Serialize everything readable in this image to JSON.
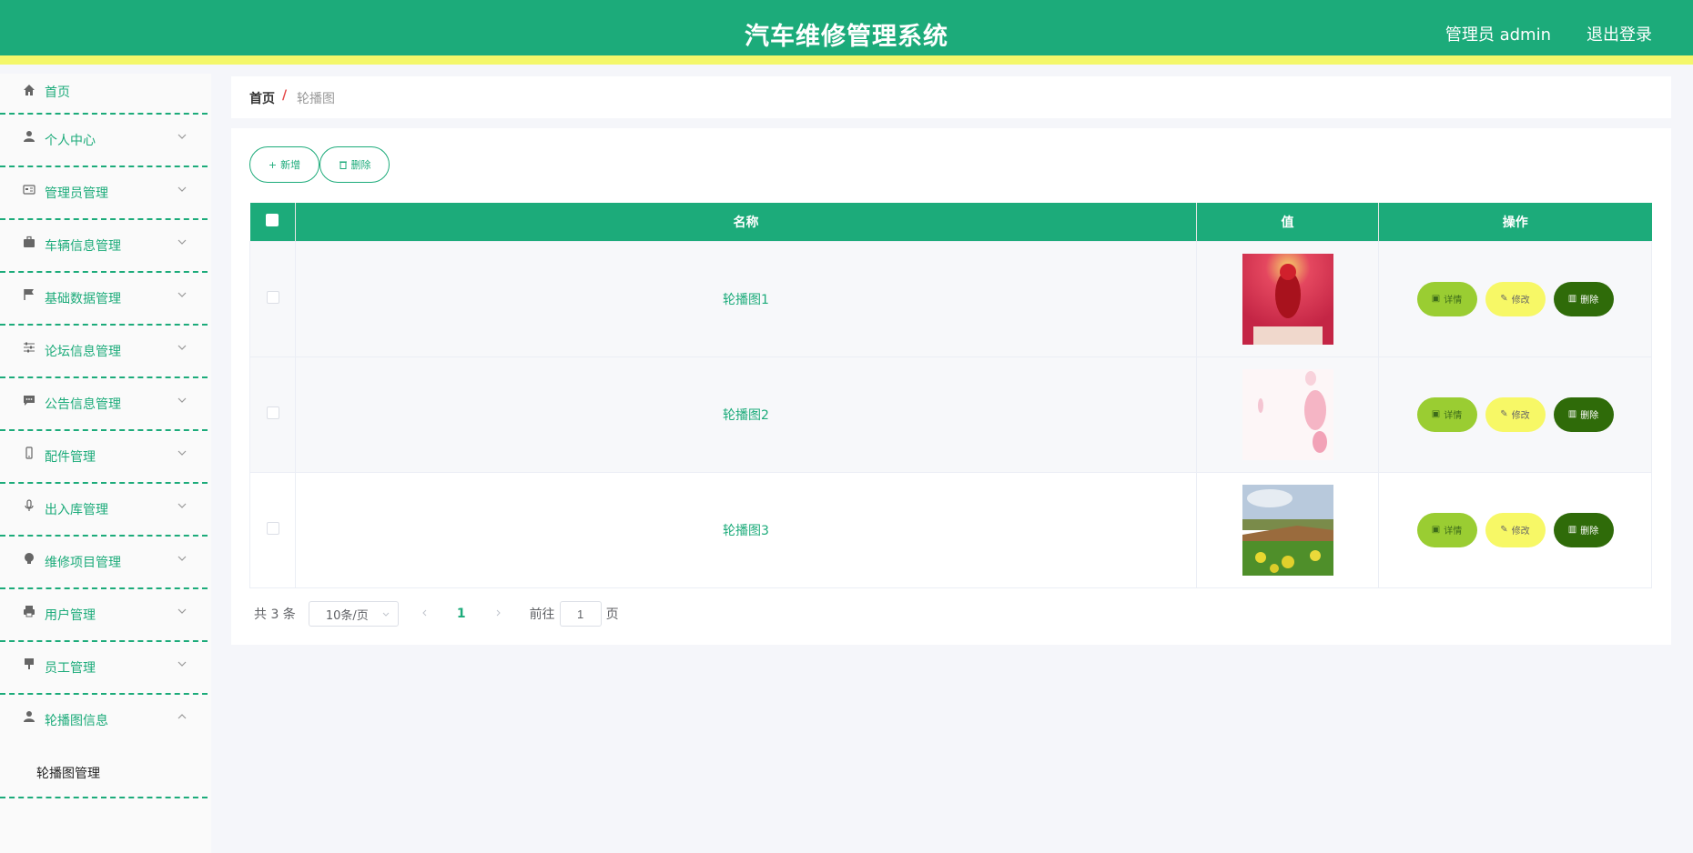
{
  "header": {
    "title": "汽车维修管理系统",
    "user": "管理员 admin",
    "logout": "退出登录"
  },
  "sidebar": {
    "items": [
      {
        "label": "首页",
        "icon": "home-icon"
      },
      {
        "label": "个人中心",
        "icon": "user-icon"
      },
      {
        "label": "管理员管理",
        "icon": "id-card-icon"
      },
      {
        "label": "车辆信息管理",
        "icon": "briefcase-icon"
      },
      {
        "label": "基础数据管理",
        "icon": "flag-icon"
      },
      {
        "label": "论坛信息管理",
        "icon": "sliders-icon"
      },
      {
        "label": "公告信息管理",
        "icon": "chat-icon"
      },
      {
        "label": "配件管理",
        "icon": "phone-icon"
      },
      {
        "label": "出入库管理",
        "icon": "microphone-icon"
      },
      {
        "label": "维修项目管理",
        "icon": "bulb-icon"
      },
      {
        "label": "用户管理",
        "icon": "printer-icon"
      },
      {
        "label": "员工管理",
        "icon": "stamp-icon"
      },
      {
        "label": "轮播图信息",
        "icon": "user-icon"
      }
    ],
    "submenu": {
      "label": "轮播图管理"
    }
  },
  "breadcrumb": {
    "home": "首页",
    "separator": "/",
    "current": "轮播图"
  },
  "toolbar": {
    "add_label": "新增",
    "delete_label": "删除"
  },
  "table": {
    "columns": [
      "名称",
      "值",
      "操作"
    ],
    "rows": [
      {
        "name": "轮播图1",
        "image": "red-figure"
      },
      {
        "name": "轮播图2",
        "image": "pink-petals"
      },
      {
        "name": "轮播图3",
        "image": "flower-field"
      }
    ],
    "actions": {
      "detail": "详情",
      "edit": "修改",
      "delete": "删除"
    }
  },
  "pagination": {
    "total": "共 3 条",
    "page_size": "10条/页",
    "current_page": "1",
    "goto_label": "前往",
    "goto_value": "1",
    "page_unit": "页"
  },
  "colors": {
    "primary": "#1cab7a",
    "accent_stripe": "#f4f76a",
    "detail_button": "#9acd32",
    "edit_button": "#f7f866",
    "delete_button": "#2f6b09"
  }
}
